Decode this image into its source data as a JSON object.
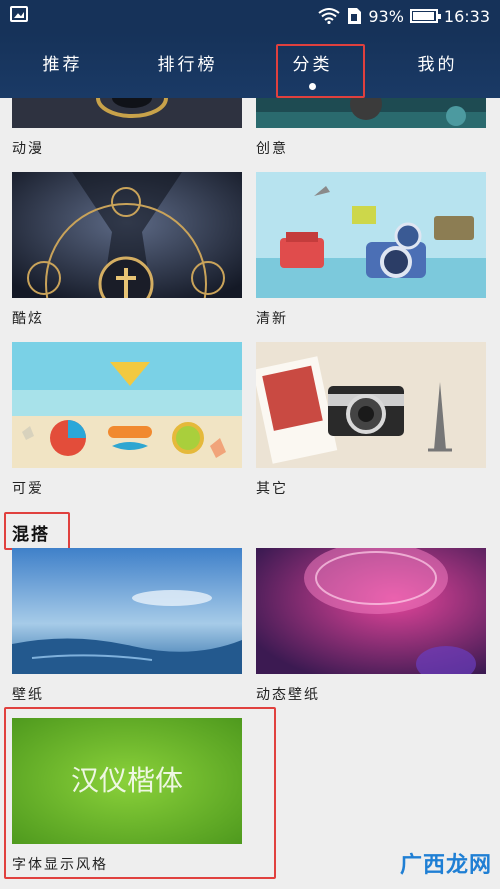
{
  "status_bar": {
    "battery": "93%",
    "time": "16:33"
  },
  "tabs": [
    {
      "label": "推荐"
    },
    {
      "label": "排行榜"
    },
    {
      "label": "分类"
    },
    {
      "label": "我的"
    }
  ],
  "categories": [
    {
      "label": "动漫"
    },
    {
      "label": "创意"
    },
    {
      "label": "酷炫"
    },
    {
      "label": "清新"
    },
    {
      "label": "可爱"
    },
    {
      "label": "其它"
    }
  ],
  "section_mixed": {
    "title": "混搭"
  },
  "mixed_items": [
    {
      "label": "壁纸"
    },
    {
      "label": "动态壁纸"
    },
    {
      "label": "字体显示风格",
      "preview_text": "汉仪楷体"
    }
  ],
  "watermark": {
    "text": "广西龙网"
  },
  "colors": {
    "header": "#163259",
    "highlight": "#e0403e"
  }
}
